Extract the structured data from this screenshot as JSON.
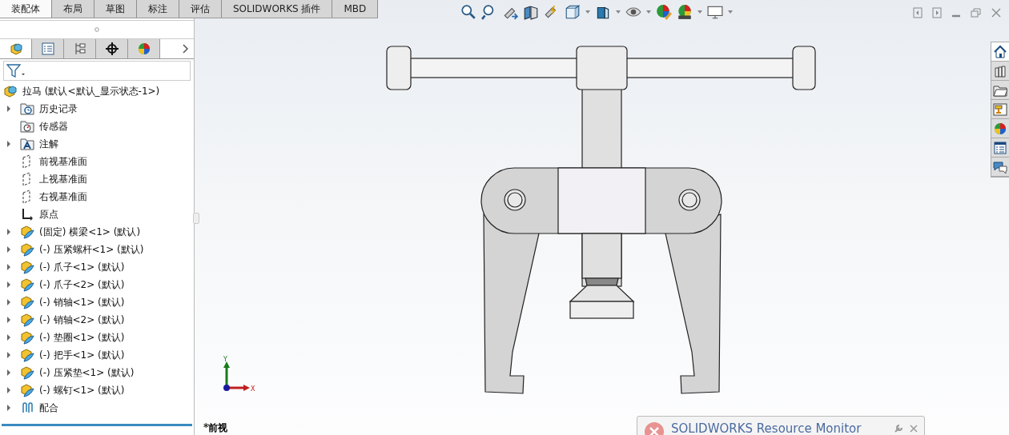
{
  "command_tabs": [
    {
      "label": "装配体",
      "selected": true
    },
    {
      "label": "布局",
      "selected": false
    },
    {
      "label": "草图",
      "selected": false
    },
    {
      "label": "标注",
      "selected": false
    },
    {
      "label": "评估",
      "selected": false
    },
    {
      "label": "SOLIDWORKS 插件",
      "selected": false
    },
    {
      "label": "MBD",
      "selected": false
    }
  ],
  "panel_tabs": [
    {
      "kind": "feature-tree",
      "selected": true
    },
    {
      "kind": "property",
      "selected": false
    },
    {
      "kind": "config",
      "selected": false
    },
    {
      "kind": "dimxpert",
      "selected": false
    },
    {
      "kind": "display",
      "selected": false
    }
  ],
  "feature_tree": {
    "root": {
      "kind": "assembly",
      "label": "拉马  (默认<默认_显示状态-1>)",
      "children": [
        {
          "kind": "history",
          "label": "历史记录",
          "expandable": true
        },
        {
          "kind": "sensors",
          "label": "传感器",
          "expandable": false
        },
        {
          "kind": "annotations",
          "label": "注解",
          "expandable": true
        },
        {
          "kind": "plane",
          "label": "前视基准面",
          "expandable": false
        },
        {
          "kind": "plane",
          "label": "上视基准面",
          "expandable": false
        },
        {
          "kind": "plane",
          "label": "右视基准面",
          "expandable": false
        },
        {
          "kind": "origin",
          "label": "原点",
          "expandable": false
        },
        {
          "kind": "component",
          "label": "(固定) 横梁<1> (默认)",
          "expandable": true
        },
        {
          "kind": "component",
          "label": "(-) 压紧螺杆<1> (默认)",
          "expandable": true
        },
        {
          "kind": "component",
          "label": "(-) 爪子<1> (默认)",
          "expandable": true
        },
        {
          "kind": "component",
          "label": "(-) 爪子<2> (默认)",
          "expandable": true
        },
        {
          "kind": "component",
          "label": "(-) 销轴<1> (默认)",
          "expandable": true
        },
        {
          "kind": "component",
          "label": "(-) 销轴<2> (默认)",
          "expandable": true
        },
        {
          "kind": "component",
          "label": "(-) 垫圈<1> (默认)",
          "expandable": true
        },
        {
          "kind": "component",
          "label": "(-) 把手<1> (默认)",
          "expandable": true
        },
        {
          "kind": "component",
          "label": "(-) 压紧垫<1> (默认)",
          "expandable": true
        },
        {
          "kind": "component",
          "label": "(-) 螺钉<1> (默认)",
          "expandable": true
        },
        {
          "kind": "mates",
          "label": "配合",
          "expandable": true
        }
      ]
    }
  },
  "viewport": {
    "triad": {
      "y_label": "Y",
      "x_label": "X"
    },
    "view_name": "*前视"
  },
  "task_pane": [
    {
      "kind": "home",
      "selected": true
    },
    {
      "kind": "library",
      "selected": false
    },
    {
      "kind": "explorer",
      "selected": false
    },
    {
      "kind": "view",
      "selected": false
    },
    {
      "kind": "appearance",
      "selected": false
    },
    {
      "kind": "properties",
      "selected": false
    },
    {
      "kind": "forum",
      "selected": false
    }
  ],
  "notification": {
    "title": "SOLIDWORKS Resource Monitor"
  }
}
